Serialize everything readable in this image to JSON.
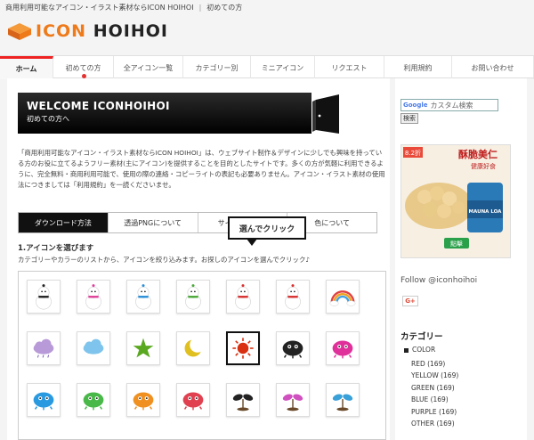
{
  "topbar": {
    "tagline": "商用利用可能なアイコン・イラスト素材ならICON HOIHOI",
    "separator": "|",
    "link": "初めての方"
  },
  "logo": {
    "text_accent": "ICON",
    "text_main": "HOIHOI"
  },
  "nav": [
    {
      "label": "ホーム",
      "active": true
    },
    {
      "label": "初めての方",
      "dot": true
    },
    {
      "label": "全アイコン一覧"
    },
    {
      "label": "カテゴリー別"
    },
    {
      "label": "ミニアイコン"
    },
    {
      "label": "リクエスト"
    },
    {
      "label": "利用規約"
    },
    {
      "label": "お問い合わせ"
    }
  ],
  "welcome": {
    "title": "WELCOME ICONHOIHOI",
    "subtitle": "初めての方へ"
  },
  "intro": "「商用利用可能なアイコン・イラスト素材ならICON HOIHOI」は、ウェブサイト制作＆デザインに少しでも興味を持っている方のお役に立てるようフリー素材(主にアイコン)を提供することを目的としたサイトです。多くの方が気軽に利用できるように、完全無料・商用利用可能で、使用の際の連絡・コピーライトの表記も必要ありません。アイコン・イラスト素材の使用法につきましては「利用規約」を一読くださいませ。",
  "tabs": [
    {
      "label": "ダウンロード方法",
      "active": true
    },
    {
      "label": "透過PNGについて"
    },
    {
      "label": "サイズについて"
    },
    {
      "label": "色について"
    }
  ],
  "step": {
    "title": "1.アイコンを選びます",
    "description": "カテゴリーやカラーのリストから、アイコンを絞り込みます。お探しのアイコンを選んでクリック♪"
  },
  "callout": "選んでクリック",
  "icons": [
    {
      "name": "snowman-black-icon",
      "color": "#222222"
    },
    {
      "name": "snowman-pink-icon",
      "color": "#e0409a"
    },
    {
      "name": "snowman-blue-icon",
      "color": "#2a8fd8"
    },
    {
      "name": "snowman-green-icon",
      "color": "#4aa838"
    },
    {
      "name": "snowman-red-icon",
      "color": "#d83030"
    },
    {
      "name": "snowman-red-icon",
      "color": "#d83030"
    },
    {
      "name": "rainbow-icon",
      "color": "#f08020"
    },
    {
      "name": "purple-cloud-icon",
      "color": "#b89ad8"
    },
    {
      "name": "blue-cloud-icon",
      "color": "#7ec4ec"
    },
    {
      "name": "star-icon",
      "color": "#5aa820"
    },
    {
      "name": "crescent-moon-icon",
      "color": "#e0c020"
    },
    {
      "name": "sun-icon",
      "color": "#d83010"
    },
    {
      "name": "black-creature-icon",
      "color": "#222222"
    },
    {
      "name": "pink-creature-icon",
      "color": "#e0309a"
    },
    {
      "name": "blue-creature-icon",
      "color": "#2a9ae0"
    },
    {
      "name": "green-creature-icon",
      "color": "#48b848"
    },
    {
      "name": "orange-creature-icon",
      "color": "#f09020"
    },
    {
      "name": "red-creature-icon",
      "color": "#e04050"
    },
    {
      "name": "black-sprout-icon",
      "color": "#222222"
    },
    {
      "name": "pink-sprout-icon",
      "color": "#d050c0"
    },
    {
      "name": "blue-sprout-icon",
      "color": "#3aa0d8"
    }
  ],
  "sidebar": {
    "search_brand": "Google",
    "search_placeholder": "カスタム検索",
    "search_button": "検索",
    "ad": {
      "headline": "酥脆美仁",
      "sub": "健康好食",
      "discount": "8.2折",
      "brand": "MAUNA LOA",
      "cta": "點擊"
    },
    "follow": "Follow @iconhoihoi",
    "gplus": "G+",
    "category_heading": "カテゴリー",
    "color_label": "COLOR",
    "colors": [
      "RED (169)",
      "YELLOW (169)",
      "GREEN (169)",
      "BLUE (169)",
      "PURPLE (169)",
      "OTHER (169)"
    ]
  },
  "colors": {
    "accent": "#ee7a1a",
    "nav_active": "#ee2222"
  }
}
